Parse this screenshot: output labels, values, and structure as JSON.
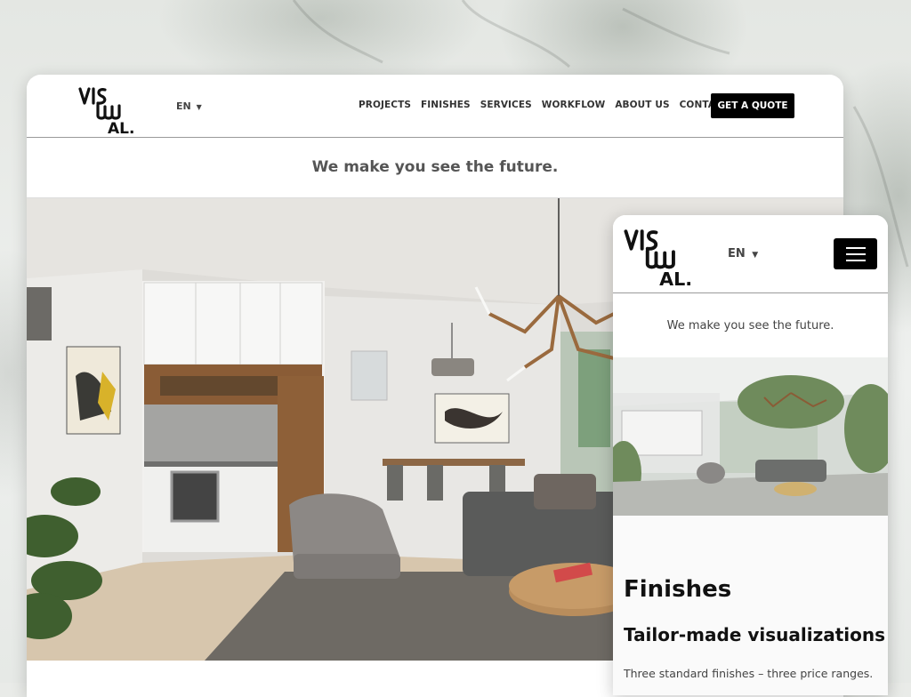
{
  "brand": {
    "logo_text": "VISUAL.",
    "accent": "#000000"
  },
  "desktop": {
    "language": "EN",
    "nav": [
      "PROJECTS",
      "FINISHES",
      "SERVICES",
      "WORKFLOW",
      "ABOUT US",
      "CONTACT"
    ],
    "cta": "GET A QUOTE",
    "tagline": "We make you see the future.",
    "hero_image": "modern-living-room-kitchen-render"
  },
  "mobile": {
    "language": "EN",
    "menu_icon": "hamburger-icon",
    "tagline": "We make you see the future.",
    "hero_image": "interior-courtyard-render",
    "heading": "Finishes",
    "subheading": "Tailor-made visualizations",
    "paragraph": "Three standard finishes – three price ranges."
  }
}
